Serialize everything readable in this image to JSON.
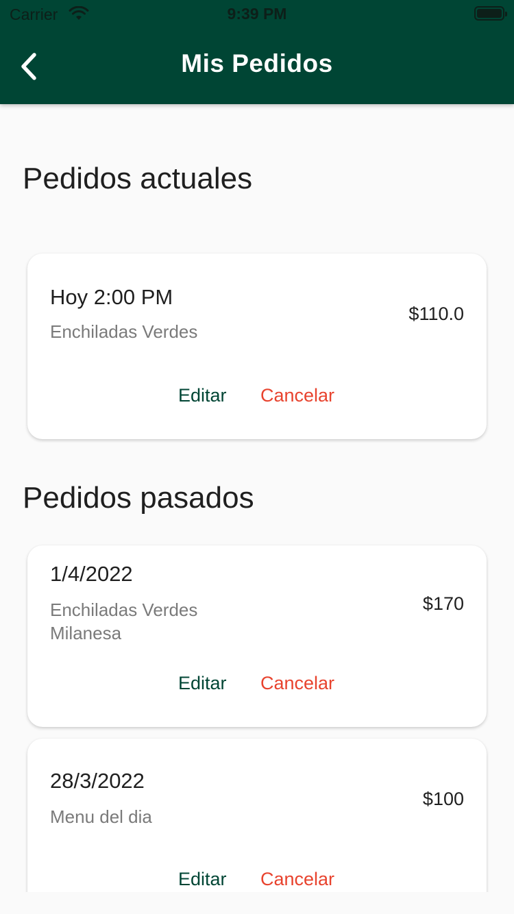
{
  "status_bar": {
    "carrier": "Carrier",
    "time": "9:39 PM"
  },
  "app_bar": {
    "title": "Mis Pedidos",
    "back_icon": "chevron-left-icon"
  },
  "colors": {
    "primary": "#004534",
    "cancel": "#e8432e",
    "background": "#fafafa"
  },
  "current": {
    "heading": "Pedidos actuales",
    "orders": [
      {
        "date": "Hoy 2:00 PM",
        "items": [
          "Enchiladas Verdes"
        ],
        "price": "$110.0",
        "edit": "Editar",
        "cancel": "Cancelar"
      }
    ]
  },
  "past": {
    "heading": "Pedidos pasados",
    "orders": [
      {
        "date": "1/4/2022",
        "items": [
          "Enchiladas Verdes",
          "Milanesa"
        ],
        "price": "$170",
        "edit": "Editar",
        "cancel": "Cancelar"
      },
      {
        "date": "28/3/2022",
        "items": [
          "Menu del dia"
        ],
        "price": "$100",
        "edit": "Editar",
        "cancel": "Cancelar"
      }
    ]
  }
}
